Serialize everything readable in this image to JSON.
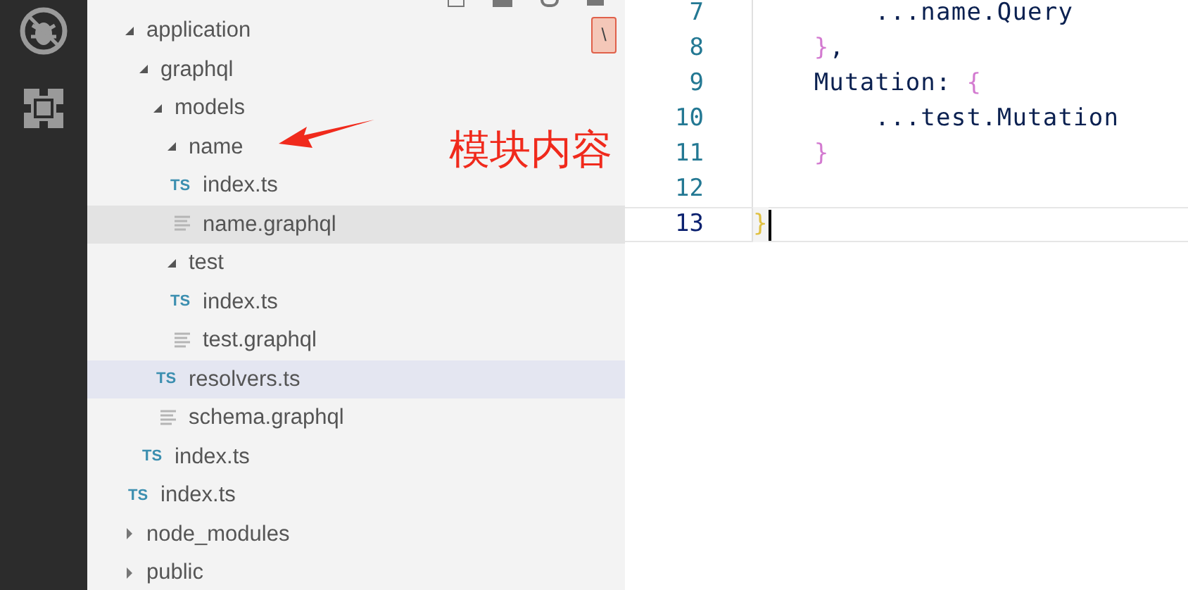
{
  "explorer": {
    "tree": [
      {
        "kind": "folder",
        "label": "application",
        "expanded": true,
        "selected": false,
        "hovered": false,
        "children": [
          {
            "kind": "folder",
            "label": "graphql",
            "expanded": true,
            "selected": false,
            "hovered": false,
            "children": [
              {
                "kind": "folder",
                "label": "models",
                "expanded": true,
                "selected": false,
                "hovered": false,
                "children": [
                  {
                    "kind": "folder",
                    "label": "name",
                    "expanded": true,
                    "selected": false,
                    "hovered": false,
                    "children": [
                      {
                        "kind": "ts",
                        "badge": "TS",
                        "label": "index.ts",
                        "selected": false,
                        "hovered": false
                      },
                      {
                        "kind": "graphql",
                        "label": "name.graphql",
                        "selected": false,
                        "hovered": true
                      }
                    ]
                  },
                  {
                    "kind": "folder",
                    "label": "test",
                    "expanded": true,
                    "selected": false,
                    "hovered": false,
                    "children": [
                      {
                        "kind": "ts",
                        "badge": "TS",
                        "label": "index.ts",
                        "selected": false,
                        "hovered": false
                      },
                      {
                        "kind": "graphql",
                        "label": "test.graphql",
                        "selected": false,
                        "hovered": false
                      }
                    ]
                  },
                  {
                    "kind": "ts",
                    "badge": "TS",
                    "label": "resolvers.ts",
                    "selected": true,
                    "hovered": false
                  },
                  {
                    "kind": "graphql",
                    "label": "schema.graphql",
                    "selected": false,
                    "hovered": false
                  }
                ]
              },
              {
                "kind": "ts",
                "badge": "TS",
                "label": "index.ts",
                "selected": false,
                "hovered": false
              }
            ]
          },
          {
            "kind": "ts",
            "badge": "TS",
            "label": "index.ts",
            "selected": false,
            "hovered": false
          }
        ]
      },
      {
        "kind": "folder",
        "label": "node_modules",
        "expanded": false,
        "selected": false,
        "hovered": false
      },
      {
        "kind": "folder",
        "label": "public",
        "expanded": false,
        "selected": false,
        "hovered": false
      }
    ],
    "tag": "\\"
  },
  "annotation": {
    "text": "模块内容"
  },
  "editor": {
    "lines": [
      {
        "number": "7",
        "current": false,
        "tokens": [
          {
            "kind": "text",
            "text": "        ...name.Query"
          }
        ]
      },
      {
        "number": "8",
        "current": false,
        "tokens": [
          {
            "kind": "brace",
            "text": "    }"
          },
          {
            "kind": "text",
            "text": ","
          }
        ]
      },
      {
        "number": "9",
        "current": false,
        "tokens": [
          {
            "kind": "text",
            "text": "    Mutation: "
          },
          {
            "kind": "brace",
            "text": "{"
          }
        ]
      },
      {
        "number": "10",
        "current": false,
        "tokens": [
          {
            "kind": "text",
            "text": "        ...test.Mutation"
          }
        ]
      },
      {
        "number": "11",
        "current": false,
        "tokens": [
          {
            "kind": "brace",
            "text": "    }"
          }
        ]
      },
      {
        "number": "12",
        "current": false
      },
      {
        "number": "13",
        "current": true,
        "tokens": [
          {
            "kind": "match",
            "text": "}"
          }
        ]
      }
    ]
  }
}
